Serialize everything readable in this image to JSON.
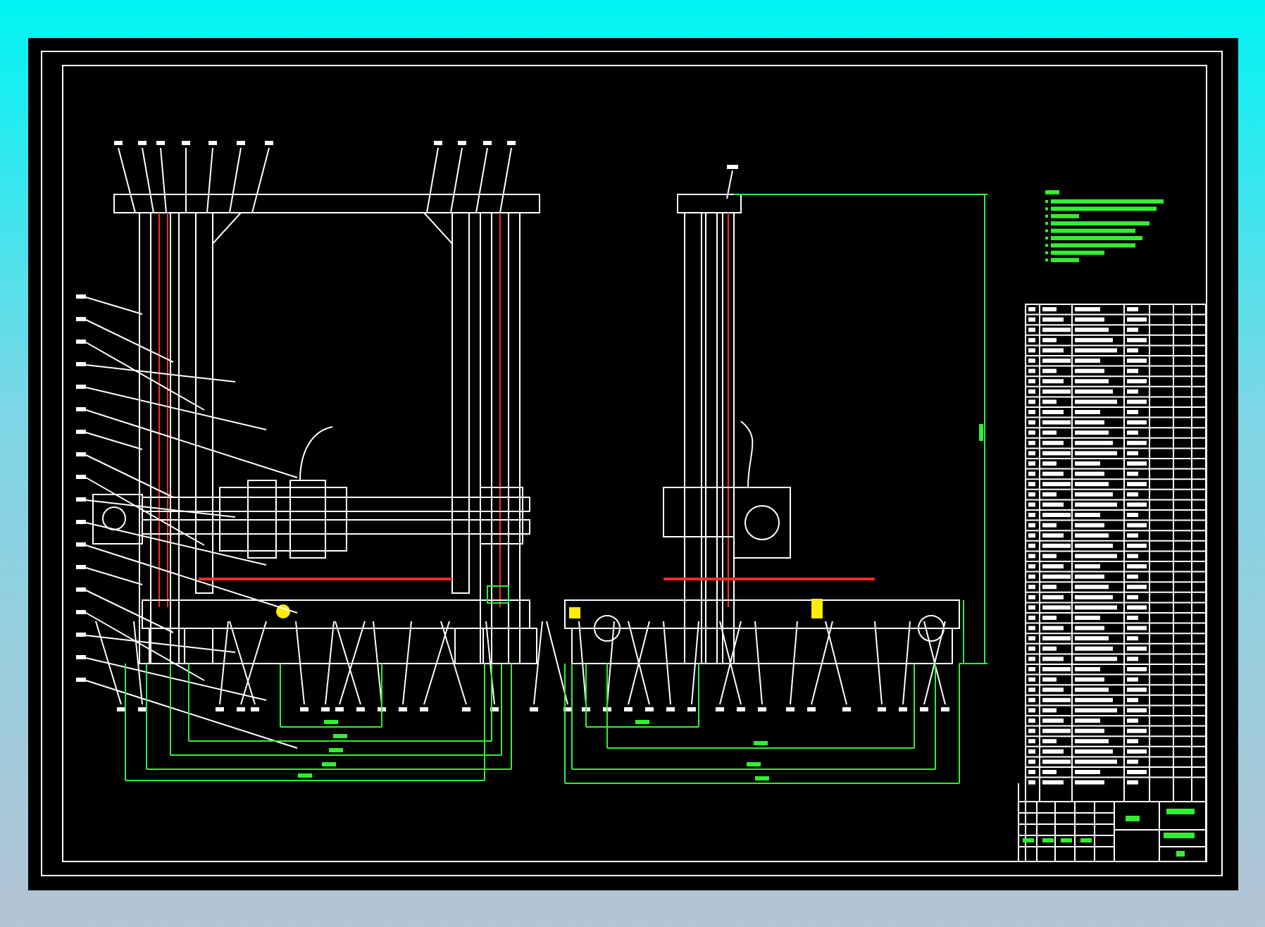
{
  "sheet": {
    "views": [
      {
        "kind": "front"
      },
      {
        "kind": "side"
      },
      {
        "kind": "notes"
      },
      {
        "kind": "parts_list"
      }
    ]
  }
}
